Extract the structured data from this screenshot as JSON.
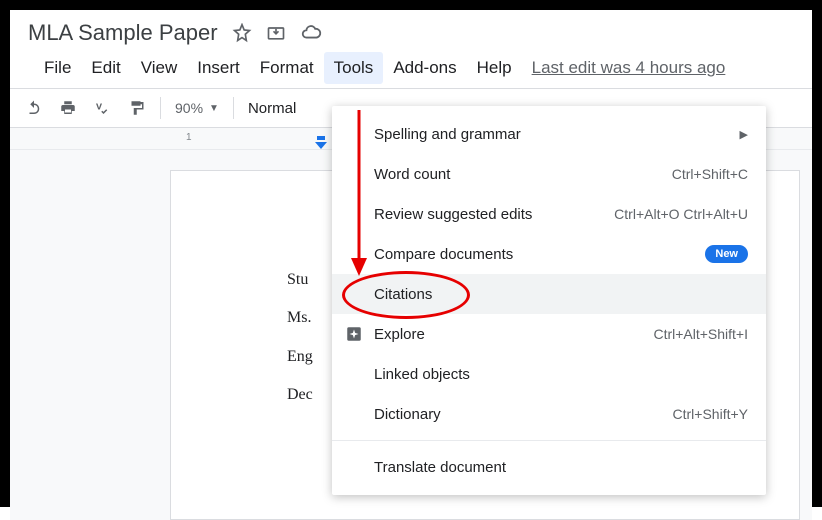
{
  "doc": {
    "title": "MLA Sample Paper"
  },
  "menubar": {
    "file": "File",
    "edit": "Edit",
    "view": "View",
    "insert": "Insert",
    "format": "Format",
    "tools": "Tools",
    "addons": "Add-ons",
    "help": "Help",
    "last_edit": "Last edit was 4 hours ago"
  },
  "toolbar": {
    "zoom": "90%",
    "style": "Normal"
  },
  "ruler": {
    "mark1": "1"
  },
  "page_text": {
    "l1": "Stu",
    "l2": "Ms.",
    "l3": "Eng",
    "l4": "Dec"
  },
  "tools_menu": {
    "spelling": "Spelling and grammar",
    "wordcount": "Word count",
    "wordcount_sc": "Ctrl+Shift+C",
    "review": "Review suggested edits",
    "review_sc": "Ctrl+Alt+O Ctrl+Alt+U",
    "compare": "Compare documents",
    "compare_badge": "New",
    "citations": "Citations",
    "explore": "Explore",
    "explore_sc": "Ctrl+Alt+Shift+I",
    "linked": "Linked objects",
    "dictionary": "Dictionary",
    "dictionary_sc": "Ctrl+Shift+Y",
    "translate": "Translate document"
  }
}
